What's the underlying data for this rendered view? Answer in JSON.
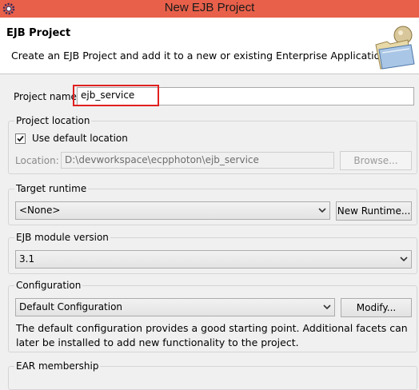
{
  "window": {
    "title": "New EJB Project",
    "icon": "eclipse-gear-icon"
  },
  "banner": {
    "heading": "EJB Project",
    "description": "Create an EJB Project and add it to a new or existing Enterprise Application.",
    "icon": "folder-wizard-icon"
  },
  "project_name": {
    "label": "Project name:",
    "value": "ejb_service"
  },
  "project_location": {
    "group_title": "Project location",
    "use_default_label": "Use default location",
    "use_default_checked": true,
    "location_label": "Location:",
    "location_value": "D:\\devworkspace\\ecpphoton\\ejb_service",
    "browse_label": "Browse..."
  },
  "target_runtime": {
    "group_title": "Target runtime",
    "selected": "<None>",
    "new_runtime_label": "New Runtime..."
  },
  "ejb_module_version": {
    "group_title": "EJB module version",
    "selected": "3.1"
  },
  "configuration": {
    "group_title": "Configuration",
    "selected": "Default Configuration",
    "modify_label": "Modify...",
    "note": "The default configuration provides a good starting point. Additional facets can later be installed to add new functionality to the project."
  },
  "ear_membership": {
    "group_title": "EAR membership"
  },
  "colors": {
    "titlebar": "#e8604a",
    "highlight": "#e02020"
  }
}
